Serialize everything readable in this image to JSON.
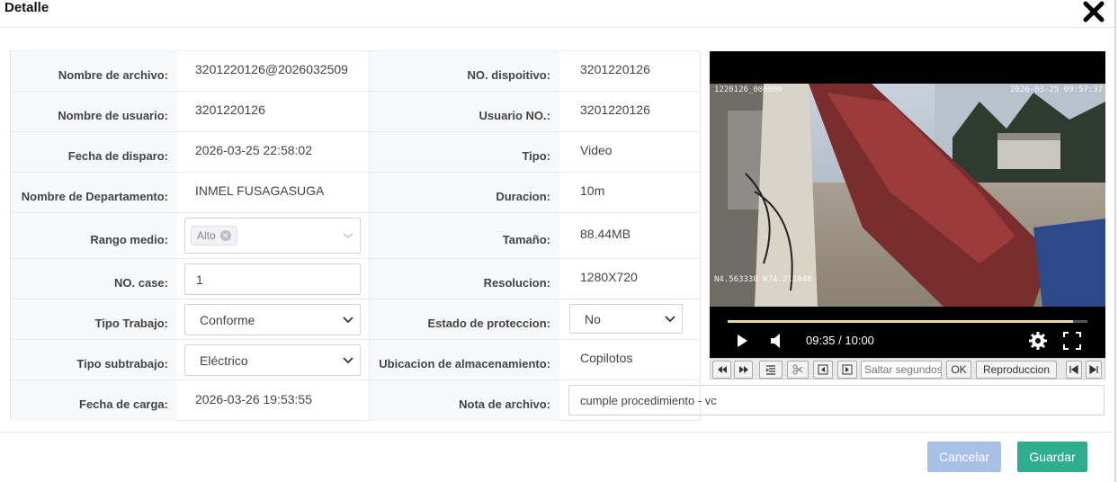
{
  "dialog": {
    "title": "Detalle"
  },
  "fields": {
    "nombre_archivo": {
      "label": "Nombre de archivo:",
      "value": "3201220126@2026032509"
    },
    "no_dispositivo": {
      "label": "NO. dispoitivo:",
      "value": "3201220126"
    },
    "nombre_usuario": {
      "label": "Nombre de usuario:",
      "value": "3201220126"
    },
    "usuario_no": {
      "label": "Usuario NO.:",
      "value": "3201220126"
    },
    "fecha_disparo": {
      "label": "Fecha de disparo:",
      "value": "2026-03-25 22:58:02"
    },
    "tipo": {
      "label": "Tipo:",
      "value": "Video"
    },
    "departamento": {
      "label": "Nombre de Departamento:",
      "value": "INMEL FUSAGASUGA"
    },
    "duracion": {
      "label": "Duracion:",
      "value": "10m"
    },
    "rango_medio": {
      "label": "Rango medio:",
      "tag": "Alto"
    },
    "tamano": {
      "label": "Tamaño:",
      "value": "88.44MB"
    },
    "no_case": {
      "label": "NO. case:",
      "value": "1"
    },
    "resolucion": {
      "label": "Resolucion:",
      "value": "1280X720"
    },
    "tipo_trabajo": {
      "label": "Tipo Trabajo:",
      "value": "Conforme"
    },
    "estado_proteccion": {
      "label": "Estado de proteccion:",
      "value": "No"
    },
    "tipo_subtrabajo": {
      "label": "Tipo subtrabajo:",
      "value": "Eléctrico"
    },
    "ubicacion": {
      "label": "Ubicacion de almacenamiento:",
      "value": "Copilotos"
    },
    "fecha_carga": {
      "label": "Fecha de carga:",
      "value": "2026-03-26 19:53:55"
    },
    "nota_archivo": {
      "label": "Nota de archivo:",
      "value": "cumple procedimiento - vc"
    }
  },
  "player": {
    "osd_top_left": "1220126_000000",
    "osd_top_right": "2026-03-25 09:57:37",
    "osd_bottom_left": "N4.563330 W74.211040",
    "time_display": "09:35 / 10:00",
    "progress_fraction": 0.96
  },
  "toolbar": {
    "seek_placeholder": "Saltar segundos",
    "ok_label": "OK",
    "playback_label": "Reproduccion"
  },
  "footer": {
    "cancel_label": "Cancelar",
    "save_label": "Guardar"
  },
  "colors": {
    "save": "#2fae8f",
    "cancel": "#a9c0e6"
  }
}
